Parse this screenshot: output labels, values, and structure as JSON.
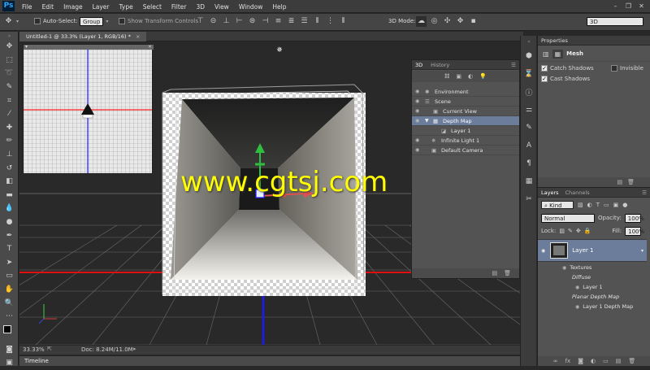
{
  "app": {
    "logo": "Ps"
  },
  "menu": [
    "File",
    "Edit",
    "Image",
    "Layer",
    "Type",
    "Select",
    "Filter",
    "3D",
    "View",
    "Window",
    "Help"
  ],
  "options": {
    "auto_select_label": "Auto-Select:",
    "auto_select_value": "Group",
    "show_transform_label": "Show Transform Controls",
    "mode_label": "3D Mode:",
    "workspace": "3D"
  },
  "document": {
    "tab_title": "Untitled-1 @ 33.3% (Layer 1, RGB/16) *"
  },
  "status": {
    "zoom": "33.33%",
    "doc_size": "Doc: 8.24M/11.0M"
  },
  "timeline": {
    "label": "Timeline"
  },
  "watermark": "www.cgtsj.com",
  "panel3d": {
    "tabs": [
      "3D",
      "History"
    ],
    "rows": [
      {
        "label": "Environment"
      },
      {
        "label": "Scene"
      },
      {
        "label": "Current View"
      },
      {
        "label": "Depth Map"
      },
      {
        "label": "Layer 1"
      },
      {
        "label": "Infinite Light 1"
      },
      {
        "label": "Default Camera"
      }
    ]
  },
  "properties": {
    "title": "Properties",
    "mesh_label": "Mesh",
    "catch_shadows": "Catch Shadows",
    "invisible": "Invisible",
    "cast_shadows": "Cast Shadows"
  },
  "layers": {
    "tabs": [
      "Layers",
      "Channels"
    ],
    "kind": "Kind",
    "blend_mode": "Normal",
    "opacity_label": "Opacity:",
    "opacity_value": "100%",
    "lock_label": "Lock:",
    "fill_label": "Fill:",
    "fill_value": "100%",
    "layer_name": "Layer 1",
    "textures": "Textures",
    "diffuse": "Diffuse",
    "diffuse_layer": "Layer 1",
    "planar_depth": "Planar Depth Map",
    "depth_layer": "Layer 1 Depth Map"
  }
}
